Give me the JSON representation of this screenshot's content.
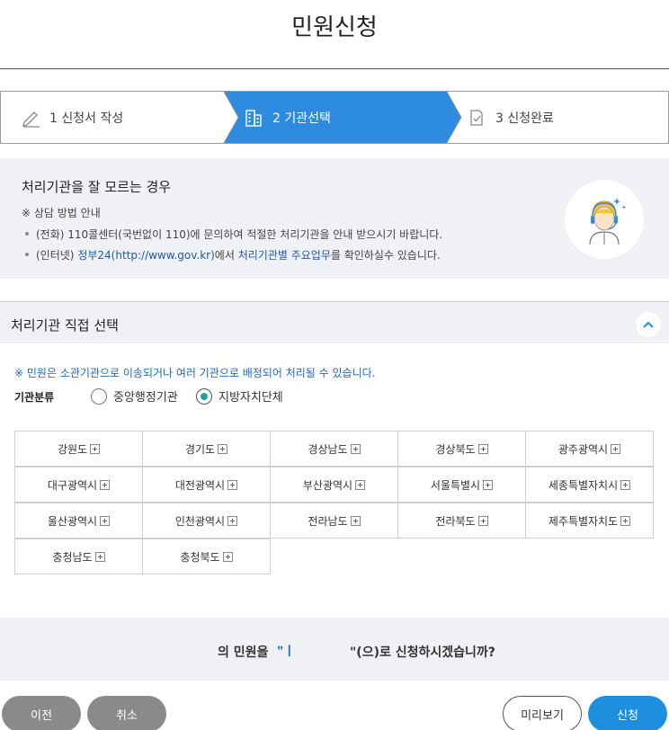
{
  "page": {
    "title": "민원신청"
  },
  "steps": [
    {
      "label": "1 신청서 작성",
      "icon": "pencil-icon"
    },
    {
      "label": "2 기관선택",
      "icon": "building-icon",
      "active": true
    },
    {
      "label": "3 신청완료",
      "icon": "document-check-icon"
    }
  ],
  "info": {
    "title": "처리기관을 잘 모르는 경우",
    "subtitle": "※ 상담 방법 안내",
    "line1": "(전화) 110콜센터(국번없이 110)에 문의하여 적절한 처리기관을 안내 받으시기 바랍니다.",
    "line2_prefix": "(인터넷) ",
    "line2_link1": "정부24(http://www.gov.kr)",
    "line2_mid": "에서 ",
    "line2_link2": "처리기관별 주요업무",
    "line2_suffix": "를 확인하실수 있습니다."
  },
  "section": {
    "title": "처리기관 직접 선택",
    "notice": "※ 민원은 소관기관으로 이송되거나 여러 기관으로 배정되어 처리될 수 있습니다.",
    "category_label": "기관분류",
    "options": [
      {
        "label": "중앙행정기관",
        "selected": false
      },
      {
        "label": "지방자치단체",
        "selected": true
      }
    ]
  },
  "regions": [
    "강원도",
    "경기도",
    "경상남도",
    "경상북도",
    "광주광역시",
    "대구광역시",
    "대전광역시",
    "부산광역시",
    "서울특별시",
    "세종특별자치시",
    "울산광역시",
    "인천광역시",
    "전라남도",
    "전라북도",
    "제주특별자치도",
    "충청남도",
    "충청북도"
  ],
  "confirm": {
    "text_a": "의 민원을",
    "mark": "\"ㅣ",
    "text_b": "\"(으)로 신청하시겠습니까?"
  },
  "buttons": {
    "prev": "이전",
    "cancel": "취소",
    "preview": "미리보기",
    "submit": "신청"
  },
  "colors": {
    "accent": "#1e8fde",
    "link": "#1e6bb8",
    "radio_on": "#1aa3a3"
  }
}
